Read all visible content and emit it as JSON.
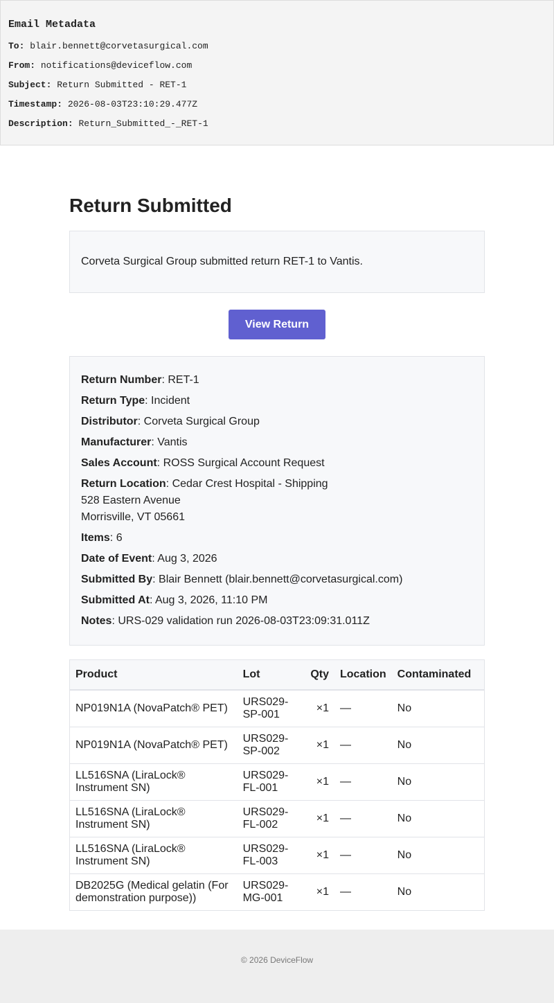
{
  "meta": {
    "title": "Email Metadata",
    "to_label": "To:",
    "to": "blair.bennett@corvetasurgical.com",
    "from_label": "From:",
    "from": "notifications@deviceflow.com",
    "subject_label": "Subject:",
    "subject": "Return Submitted - RET-1",
    "timestamp_label": "Timestamp:",
    "timestamp": "2026-08-03T23:10:29.477Z",
    "description_label": "Description:",
    "description": "Return_Submitted_-_RET-1"
  },
  "email": {
    "title": "Return Submitted",
    "intro": "Corveta Surgical Group submitted return RET-1 to Vantis.",
    "button_label": "View Return",
    "accent_color": "#6060d0"
  },
  "details": {
    "return_number_label": "Return Number",
    "return_number": "RET-1",
    "return_type_label": "Return Type",
    "return_type": "Incident",
    "distributor_label": "Distributor",
    "distributor": "Corveta Surgical Group",
    "manufacturer_label": "Manufacturer",
    "manufacturer": "Vantis",
    "sales_account_label": "Sales Account",
    "sales_account": "ROSS Surgical Account Request",
    "return_location_label": "Return Location",
    "return_location_line1": "Cedar Crest Hospital - Shipping",
    "return_location_line2": "528 Eastern Avenue",
    "return_location_line3": "Morrisville, VT 05661",
    "items_label": "Items",
    "items": "6",
    "date_of_event_label": "Date of Event",
    "date_of_event": "Aug 3, 2026",
    "submitted_by_label": "Submitted By",
    "submitted_by": "Blair Bennett (blair.bennett@corvetasurgical.com)",
    "submitted_at_label": "Submitted At",
    "submitted_at": "Aug 3, 2026, 11:10 PM",
    "notes_label": "Notes",
    "notes": "URS-029 validation run 2026-08-03T23:09:31.011Z"
  },
  "table": {
    "headers": {
      "product": "Product",
      "lot": "Lot",
      "qty": "Qty",
      "location": "Location",
      "contaminated": "Contaminated"
    },
    "rows": [
      {
        "product": "NP019N1A (NovaPatch® PET)",
        "lot": "URS029-SP-001",
        "qty": "×1",
        "location": "—",
        "contaminated": "No"
      },
      {
        "product": "NP019N1A (NovaPatch® PET)",
        "lot": "URS029-SP-002",
        "qty": "×1",
        "location": "—",
        "contaminated": "No"
      },
      {
        "product": "LL516SNA (LiraLock® Instrument SN)",
        "lot": "URS029-FL-001",
        "qty": "×1",
        "location": "—",
        "contaminated": "No"
      },
      {
        "product": "LL516SNA (LiraLock® Instrument SN)",
        "lot": "URS029-FL-002",
        "qty": "×1",
        "location": "—",
        "contaminated": "No"
      },
      {
        "product": "LL516SNA (LiraLock® Instrument SN)",
        "lot": "URS029-FL-003",
        "qty": "×1",
        "location": "—",
        "contaminated": "No"
      },
      {
        "product": "DB2025G (Medical gelatin (For demonstration purpose))",
        "lot": "URS029-MG-001",
        "qty": "×1",
        "location": "—",
        "contaminated": "No"
      }
    ]
  },
  "footer": {
    "text": "© 2026 DeviceFlow"
  }
}
